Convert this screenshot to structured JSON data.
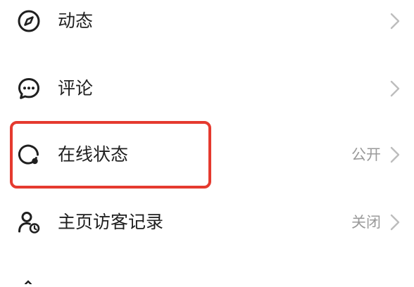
{
  "settings": {
    "items": [
      {
        "label": "动态",
        "value": "",
        "icon": "compass-icon",
        "highlighted": false
      },
      {
        "label": "评论",
        "value": "",
        "icon": "chat-bubble-icon",
        "highlighted": false
      },
      {
        "label": "在线状态",
        "value": "公开",
        "icon": "online-status-icon",
        "highlighted": true
      },
      {
        "label": "主页访客记录",
        "value": "关闭",
        "icon": "visitor-clock-icon",
        "highlighted": false
      }
    ]
  },
  "colors": {
    "text": "#1f1f1f",
    "secondary_text": "#9a9a9a",
    "chevron": "#bdbdbd",
    "icon": "#1f1f1f",
    "highlight": "#e53a2f"
  }
}
